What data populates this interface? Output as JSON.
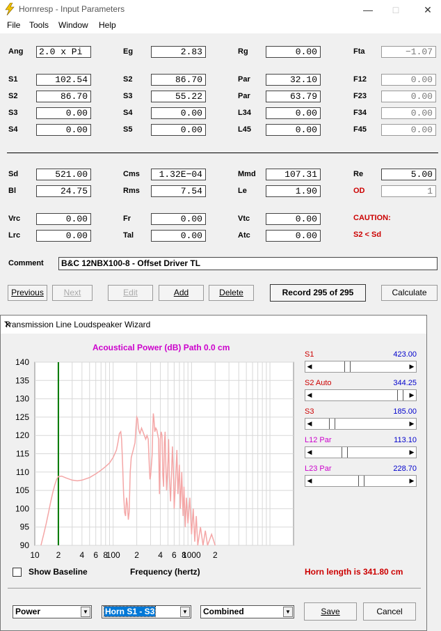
{
  "window": {
    "title": "Hornresp - Input Parameters"
  },
  "menu": [
    "File",
    "Tools",
    "Window",
    "Help"
  ],
  "params": [
    {
      "label": "Ang",
      "value": "2.0 x Pi"
    },
    {
      "label": "Eg",
      "value": "2.83"
    },
    {
      "label": "Rg",
      "value": "0.00"
    },
    {
      "label": "Fta",
      "value": "−1.07"
    },
    {
      "label": "S1",
      "value": "102.54"
    },
    {
      "label": "S2",
      "value": "86.70"
    },
    {
      "label": "Par",
      "value": "32.10"
    },
    {
      "label": "F12",
      "value": "0.00"
    },
    {
      "label": "S2",
      "value": "86.70"
    },
    {
      "label": "S3",
      "value": "55.22"
    },
    {
      "label": "Par",
      "value": "63.79"
    },
    {
      "label": "F23",
      "value": "0.00"
    },
    {
      "label": "S3",
      "value": "0.00"
    },
    {
      "label": "S4",
      "value": "0.00"
    },
    {
      "label": "L34",
      "value": "0.00"
    },
    {
      "label": "F34",
      "value": "0.00"
    },
    {
      "label": "S4",
      "value": "0.00"
    },
    {
      "label": "S5",
      "value": "0.00"
    },
    {
      "label": "L45",
      "value": "0.00"
    },
    {
      "label": "F45",
      "value": "0.00"
    },
    {
      "label": "Sd",
      "value": "521.00"
    },
    {
      "label": "Cms",
      "value": "1.32E−04"
    },
    {
      "label": "Mmd",
      "value": "107.31"
    },
    {
      "label": "Re",
      "value": "5.00"
    },
    {
      "label": "Bl",
      "value": "24.75"
    },
    {
      "label": "Rms",
      "value": "7.54"
    },
    {
      "label": "Le",
      "value": "1.90"
    },
    {
      "label": "OD",
      "value": "1"
    },
    {
      "label": "Vrc",
      "value": "0.00"
    },
    {
      "label": "Fr",
      "value": "0.00"
    },
    {
      "label": "Vtc",
      "value": "0.00"
    },
    {
      "label": "Lrc",
      "value": "0.00"
    },
    {
      "label": "Tal",
      "value": "0.00"
    },
    {
      "label": "Atc",
      "value": "0.00"
    }
  ],
  "caution": {
    "title": "CAUTION:",
    "message": "S2 < Sd"
  },
  "comment": {
    "label": "Comment",
    "value": "B&C 12NBX100-8 - Offset Driver TL"
  },
  "buttons": {
    "previous": "Previous",
    "next": "Next",
    "edit": "Edit",
    "add": "Add",
    "delete": "Delete",
    "record": "Record 295 of 295",
    "calculate": "Calculate"
  },
  "wizard": {
    "title": "Transmission Line Loudspeaker Wizard",
    "chart_title": "Acoustical Power (dB)   Path 0.0 cm",
    "x_label": "Frequency (hertz)",
    "show_baseline": "Show Baseline",
    "horn_length": "Horn length is 341.80 cm",
    "sliders": [
      {
        "label": "S1",
        "value": "423.00",
        "pos": 0.34
      },
      {
        "label": "S2  Auto",
        "value": "344.25",
        "pos": 0.94
      },
      {
        "label": "S3",
        "value": "185.00",
        "pos": 0.17
      },
      {
        "label": "L12  Par",
        "value": "113.10",
        "pos": 0.31
      },
      {
        "label": "L23  Par",
        "value": "228.70",
        "pos": 0.5
      }
    ],
    "combos": [
      "Power",
      "Horn S1 - S3",
      "Combined"
    ],
    "save": "Save",
    "cancel": "Cancel"
  },
  "chart_data": {
    "type": "line",
    "title": "Acoustical Power (dB)   Path 0.0 cm",
    "xlabel": "Frequency (hertz)",
    "ylabel": "",
    "x_scale": "log",
    "xlim": [
      10,
      20000
    ],
    "ylim": [
      90,
      140
    ],
    "y_ticks": [
      140,
      135,
      130,
      125,
      120,
      115,
      110,
      105,
      100,
      95,
      90
    ],
    "x_ticks": [
      {
        "v": 10,
        "t": "10"
      },
      {
        "v": 20,
        "t": "2"
      },
      {
        "v": 40,
        "t": "4"
      },
      {
        "v": 60,
        "t": "6"
      },
      {
        "v": 80,
        "t": "8"
      },
      {
        "v": 100,
        "t": "100"
      },
      {
        "v": 200,
        "t": "2"
      },
      {
        "v": 400,
        "t": "4"
      },
      {
        "v": 600,
        "t": "6"
      },
      {
        "v": 800,
        "t": "8"
      },
      {
        "v": 1000,
        "t": "1000"
      },
      {
        "v": 2000,
        "t": "2"
      }
    ],
    "marker_x": 20,
    "series": [
      {
        "color": "#f4a6a6",
        "points": [
          [
            12,
            90
          ],
          [
            13,
            93
          ],
          [
            14,
            96
          ],
          [
            15,
            99
          ],
          [
            16,
            102
          ],
          [
            17,
            104.5
          ],
          [
            18,
            106.5
          ],
          [
            19,
            108
          ],
          [
            20,
            108.8
          ],
          [
            22,
            108.9
          ],
          [
            25,
            108.4
          ],
          [
            30,
            107.8
          ],
          [
            35,
            107.6
          ],
          [
            40,
            107.8
          ],
          [
            50,
            108.5
          ],
          [
            60,
            109.5
          ],
          [
            70,
            110.5
          ],
          [
            80,
            111.5
          ],
          [
            90,
            112.5
          ],
          [
            100,
            114
          ],
          [
            110,
            116
          ],
          [
            115,
            118
          ],
          [
            120,
            120.5
          ],
          [
            125,
            121
          ],
          [
            128,
            119
          ],
          [
            132,
            112
          ],
          [
            136,
            104
          ],
          [
            140,
            99
          ],
          [
            144,
            98
          ],
          [
            148,
            103
          ],
          [
            152,
            101
          ],
          [
            156,
            97
          ],
          [
            160,
            99
          ],
          [
            165,
            110
          ],
          [
            170,
            114
          ],
          [
            180,
            116
          ],
          [
            190,
            118
          ],
          [
            195,
            122
          ],
          [
            200,
            125
          ],
          [
            205,
            124.5
          ],
          [
            210,
            122
          ],
          [
            215,
            121
          ],
          [
            220,
            120.5
          ],
          [
            230,
            122
          ],
          [
            240,
            121
          ],
          [
            250,
            120
          ],
          [
            260,
            119
          ],
          [
            270,
            120
          ],
          [
            280,
            119
          ],
          [
            290,
            111
          ],
          [
            295,
            108
          ],
          [
            300,
            109
          ],
          [
            310,
            113
          ],
          [
            315,
            115
          ],
          [
            320,
            121.5
          ],
          [
            325,
            126
          ],
          [
            330,
            125
          ],
          [
            340,
            121
          ],
          [
            350,
            122
          ],
          [
            360,
            121.5
          ],
          [
            380,
            119
          ],
          [
            385,
            110
          ],
          [
            390,
            104
          ],
          [
            395,
            108
          ],
          [
            400,
            119
          ],
          [
            410,
            121
          ],
          [
            420,
            120
          ],
          [
            430,
            109
          ],
          [
            440,
            106
          ],
          [
            450,
            118
          ],
          [
            460,
            121
          ],
          [
            470,
            112
          ],
          [
            480,
            105
          ],
          [
            500,
            113
          ],
          [
            510,
            119
          ],
          [
            520,
            109
          ],
          [
            540,
            102
          ],
          [
            560,
            112
          ],
          [
            570,
            117
          ],
          [
            590,
            108
          ],
          [
            600,
            100
          ],
          [
            620,
            106
          ],
          [
            650,
            116
          ],
          [
            670,
            104
          ],
          [
            700,
            112
          ],
          [
            720,
            100
          ],
          [
            750,
            110
          ],
          [
            780,
            98
          ],
          [
            800,
            106
          ],
          [
            830,
            95
          ],
          [
            860,
            103
          ],
          [
            900,
            96
          ],
          [
            950,
            103
          ],
          [
            1000,
            93
          ],
          [
            1050,
            100
          ],
          [
            1100,
            91
          ],
          [
            1150,
            98
          ],
          [
            1200,
            90
          ],
          [
            1300,
            95
          ],
          [
            1400,
            90
          ],
          [
            1500,
            94
          ],
          [
            1600,
            90
          ],
          [
            1800,
            93
          ],
          [
            2000,
            90
          ]
        ]
      }
    ]
  }
}
